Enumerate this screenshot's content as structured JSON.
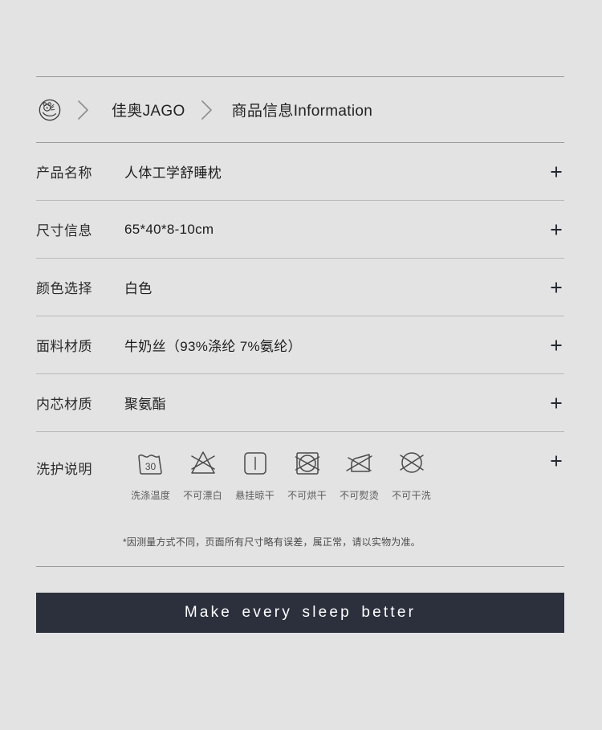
{
  "theme": {
    "background": "#e3e3e3",
    "text": "#2b2b2b",
    "divider": "#9a9a9a",
    "footer_bg": "#2b303c",
    "footer_text": "#ffffff",
    "icon_stroke": "#4a4a4a"
  },
  "breadcrumb": {
    "logo_icon": "jago-brand-logo-icon",
    "separator_icon": "chevron-right-icon",
    "brand": "佳奥JAGO",
    "section": "商品信息Information"
  },
  "specs": {
    "expand_icon": "plus-icon",
    "rows": [
      {
        "label": "产品名称",
        "value": "人体工学舒睡枕"
      },
      {
        "label": "尺寸信息",
        "value": "65*40*8-10cm"
      },
      {
        "label": "颜色选择",
        "value": "白色"
      },
      {
        "label": "面料材质",
        "value": "牛奶丝（93%涤纶 7%氨纶）"
      },
      {
        "label": "内芯材质",
        "value": "聚氨酯"
      }
    ]
  },
  "care": {
    "label": "洗护说明",
    "expand_icon": "plus-icon",
    "items": [
      {
        "icon": "wash-tub-30-icon",
        "caption": "洗涤温度"
      },
      {
        "icon": "do-not-bleach-icon",
        "caption": "不可漂白"
      },
      {
        "icon": "line-dry-icon",
        "caption": "悬挂晾干"
      },
      {
        "icon": "do-not-tumble-dry-icon",
        "caption": "不可烘干"
      },
      {
        "icon": "do-not-iron-icon",
        "caption": "不可熨烫"
      },
      {
        "icon": "do-not-dry-clean-icon",
        "caption": "不可干洗"
      }
    ],
    "wash_temperature": "30",
    "note": "*因测量方式不同，页面所有尺寸略有误差，属正常，请以实物为准。"
  },
  "footer": {
    "slogan": "Make every sleep better"
  }
}
